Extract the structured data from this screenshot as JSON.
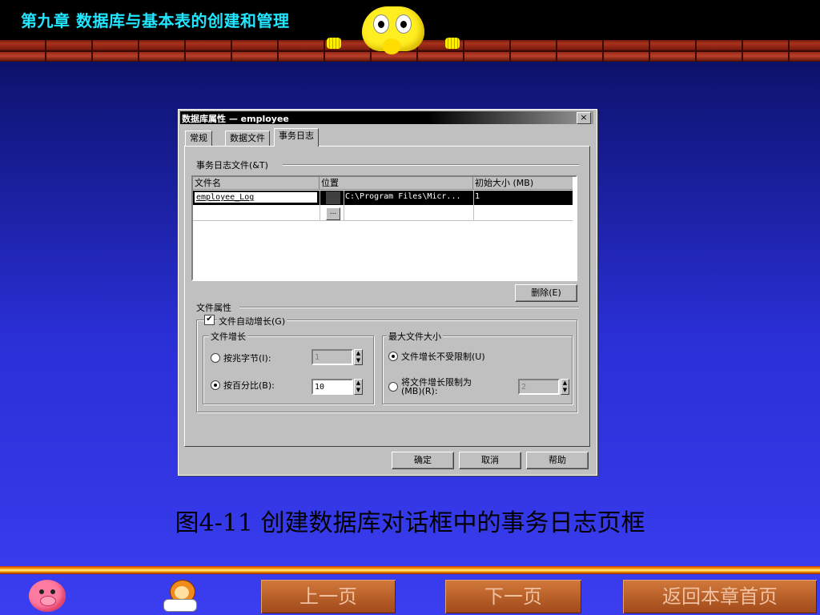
{
  "header": {
    "title": "第九章   数据库与基本表的创建和管理"
  },
  "dialog": {
    "title": "数据库属性 — employee",
    "close": "×",
    "tabs": [
      "常规",
      "数据文件",
      "事务日志"
    ],
    "active_tab": "事务日志",
    "log_files_group": "事务日志文件(&T)",
    "grid": {
      "headers": [
        "文件名",
        "位置",
        "初始大小 (MB)"
      ],
      "rows": [
        {
          "name": "employee_Log",
          "location": "C:\\Program Files\\Micr...",
          "size": "1"
        }
      ],
      "browse": "..."
    },
    "delete_button": "删除(E)",
    "file_props_group": "文件属性",
    "auto_grow": {
      "label": "文件自动增长(G)",
      "checked": true
    },
    "growth_group": "文件增长",
    "by_mb": {
      "label": "按兆字节(I):",
      "value": "1"
    },
    "by_percent": {
      "label": "按百分比(B):",
      "value": "10",
      "selected": true
    },
    "max_size_group": "最大文件大小",
    "unrestricted": {
      "label": "文件增长不受限制(U)",
      "selected": true
    },
    "restrict": {
      "label_line1": "将文件增长限制为",
      "label_line2": "(MB)(R):",
      "value": "2"
    },
    "buttons": {
      "ok": "确定",
      "cancel": "取消",
      "help": "帮助"
    }
  },
  "caption": "图4-11   创建数据库对话框中的事务日志页框",
  "footer": {
    "prev": "上一页",
    "next": "下一页",
    "home": "返回本章首页"
  },
  "icons": [
    "pig-icon",
    "monkey-icon",
    "mascot-icon"
  ]
}
